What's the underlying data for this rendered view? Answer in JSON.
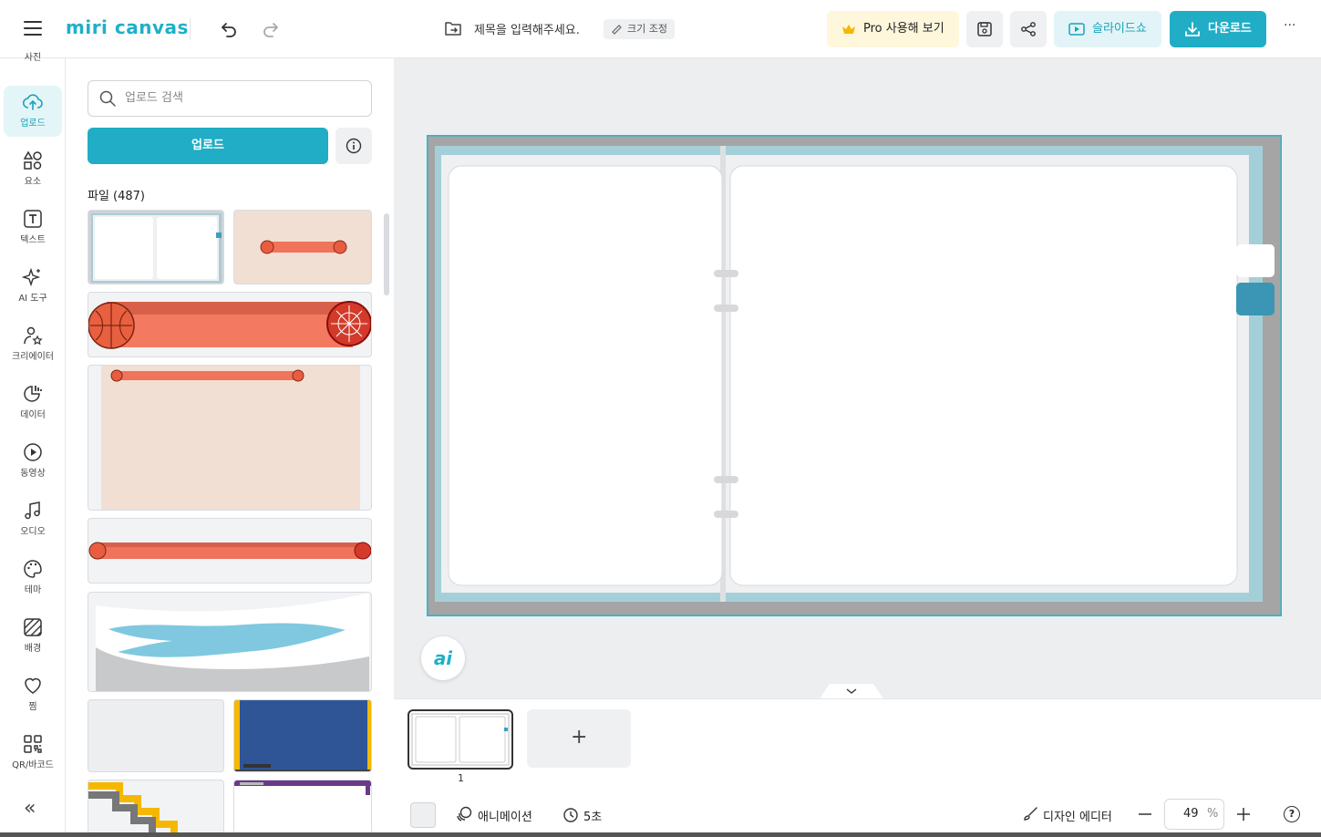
{
  "app": {
    "logo": "miri canvas",
    "title_placeholder": "제목을 입력해주세요.",
    "resize_label": "크기 조정",
    "pro_label": "Pro 사용해 보기",
    "slideshow_label": "슬라이드쇼",
    "download_label": "다운로드",
    "more_label": "···"
  },
  "sidebar": {
    "items": [
      {
        "label": "사진"
      },
      {
        "label": "업로드"
      },
      {
        "label": "요소"
      },
      {
        "label": "텍스트"
      },
      {
        "label": "AI 도구"
      },
      {
        "label": "크리에이터"
      },
      {
        "label": "데이터"
      },
      {
        "label": "동영상"
      },
      {
        "label": "오디오"
      },
      {
        "label": "테마"
      },
      {
        "label": "배경"
      },
      {
        "label": "찜"
      },
      {
        "label": "QR/바코드"
      }
    ],
    "collapse_label": "«"
  },
  "panel": {
    "search_placeholder": "업로드 검색",
    "upload_label": "업로드",
    "file_count_label": "파일 (487)"
  },
  "canvas": {
    "ai_badge": "ai"
  },
  "bottom": {
    "page_number": "1",
    "add_page_label": "+",
    "animation_label": "애니메이션",
    "duration_label": "5초",
    "design_editor_label": "디자인 에디터",
    "zoom_value": "49",
    "zoom_unit": "%",
    "help_label": "?"
  },
  "colors": {
    "accent": "#20adc5",
    "pro_bg": "#fff7dc",
    "canvas_selection": "#23b8d0"
  }
}
